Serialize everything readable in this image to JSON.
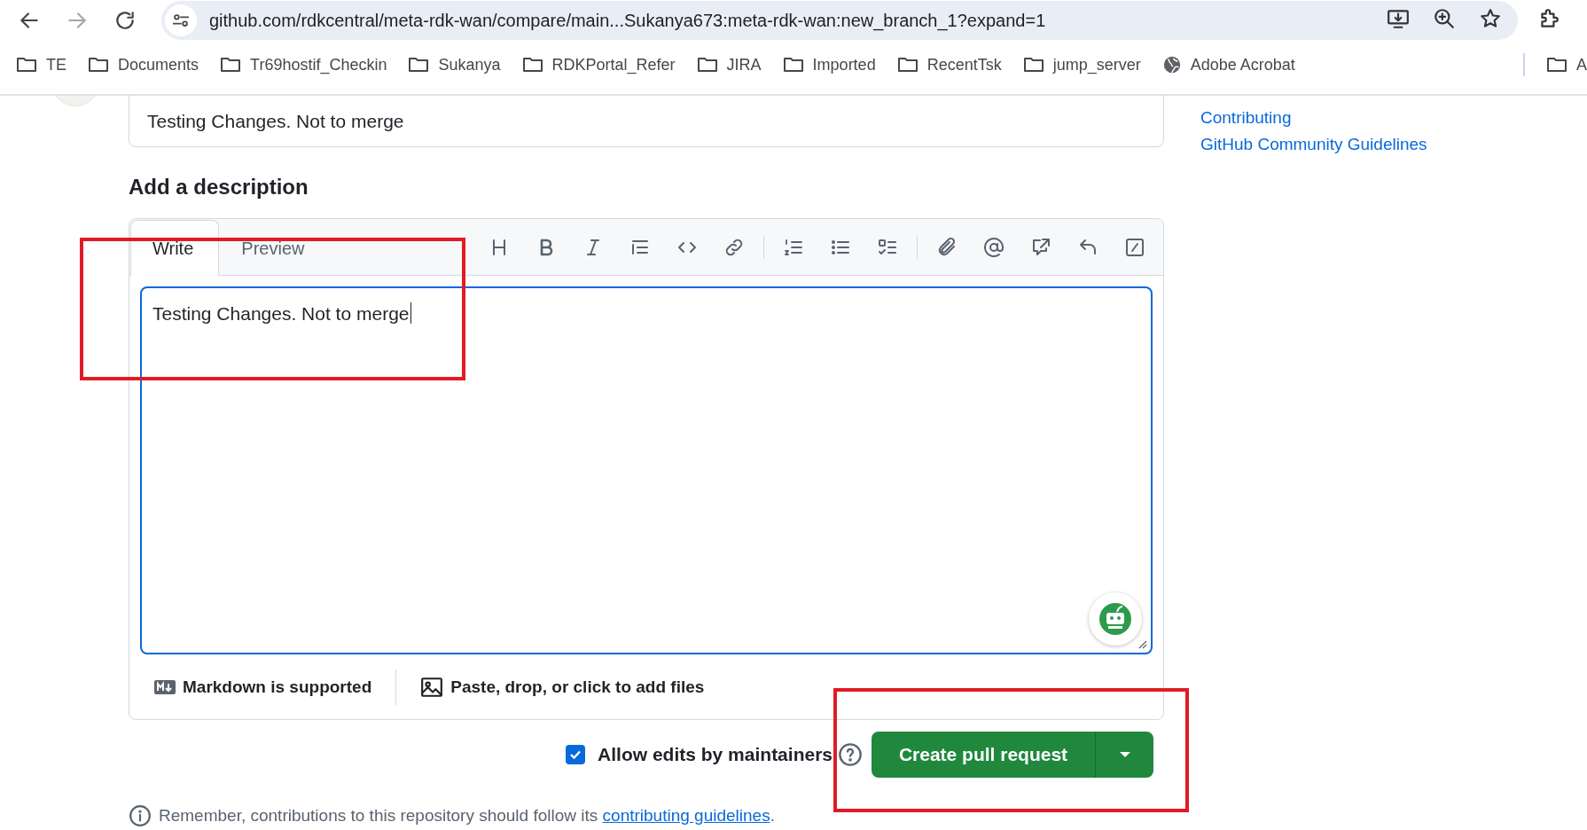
{
  "browser": {
    "url": "github.com/rdkcentral/meta-rdk-wan/compare/main...Sukanya673:meta-rdk-wan:new_branch_1?expand=1",
    "bookmarks": [
      {
        "kind": "folder",
        "label": "TE"
      },
      {
        "kind": "folder",
        "label": "Documents"
      },
      {
        "kind": "folder",
        "label": "Tr69hostif_Checkin"
      },
      {
        "kind": "folder",
        "label": "Sukanya"
      },
      {
        "kind": "folder",
        "label": "RDKPortal_Refer"
      },
      {
        "kind": "folder",
        "label": "JIRA"
      },
      {
        "kind": "folder",
        "label": "Imported"
      },
      {
        "kind": "folder",
        "label": "RecentTsk"
      },
      {
        "kind": "folder",
        "label": "jump_server"
      },
      {
        "kind": "site",
        "label": "Adobe Acrobat"
      },
      {
        "kind": "folder",
        "label": "A"
      }
    ]
  },
  "title_field": {
    "value": "Testing Changes. Not to merge"
  },
  "description": {
    "heading": "Add a description",
    "tabs": [
      {
        "label": "Write",
        "selected": true
      },
      {
        "label": "Preview",
        "selected": false
      }
    ],
    "body": "Testing Changes. Not to merge",
    "footer": [
      {
        "kind": "markdown",
        "label": "Markdown is supported"
      },
      {
        "kind": "image",
        "label": "Paste, drop, or click to add files"
      }
    ]
  },
  "allow_edits": {
    "label": "Allow edits by maintainers",
    "checked": true
  },
  "submit": {
    "label": "Create pull request"
  },
  "note": {
    "text": "Remember, contributions to this repository should follow its ",
    "link": "contributing guidelines",
    "end": "."
  },
  "sidebar": {
    "links": [
      "Contributing",
      "GitHub Community Guidelines"
    ]
  },
  "annotations": [
    {
      "kind": "rectangle"
    },
    {
      "kind": "rectangle"
    }
  ]
}
